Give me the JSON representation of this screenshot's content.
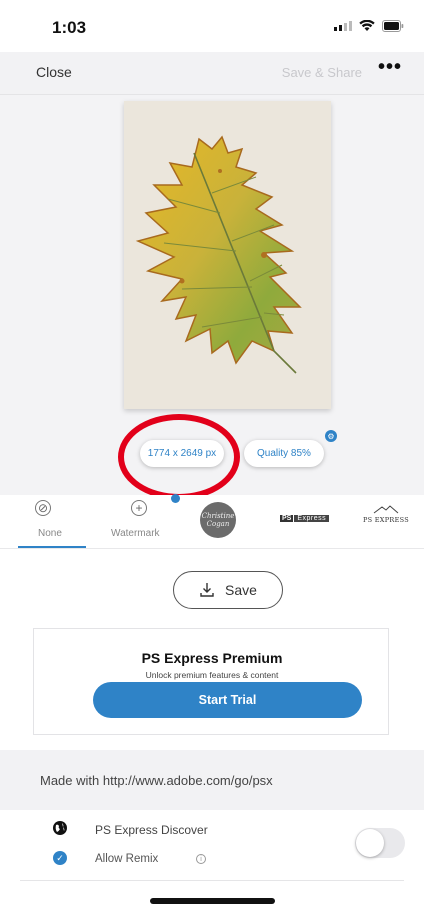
{
  "status_bar": {
    "time": "1:03"
  },
  "navbar": {
    "close_label": "Close",
    "share_label": "Save & Share",
    "more_label": "•••"
  },
  "preview": {
    "dimensions": "1774 x 2649 px",
    "quality": "Quality 85%"
  },
  "watermarks": {
    "selected": "None",
    "items": [
      {
        "label": "None",
        "icon": "none-watermark-icon"
      },
      {
        "label": "Watermark",
        "icon": "add-watermark-icon"
      },
      {
        "label": "Christine Cogan",
        "icon": "badge-watermark"
      },
      {
        "label": "PS Express",
        "icon": "psx-box-watermark"
      },
      {
        "label": "PS EXPRESS",
        "icon": "psx-mountain-watermark"
      }
    ]
  },
  "save": {
    "label": "Save"
  },
  "premium": {
    "title": "PS Express Premium",
    "subtitle": "Unlock premium features & content",
    "cta": "Start Trial"
  },
  "made_with": "Made with http://www.adobe.com/go/psx",
  "discover": {
    "label": "PS Express Discover",
    "enabled": false
  },
  "remix": {
    "label": "Allow Remix",
    "checked": true
  },
  "colors": {
    "accent": "#2f83c7",
    "annotation": "#e2001a"
  }
}
